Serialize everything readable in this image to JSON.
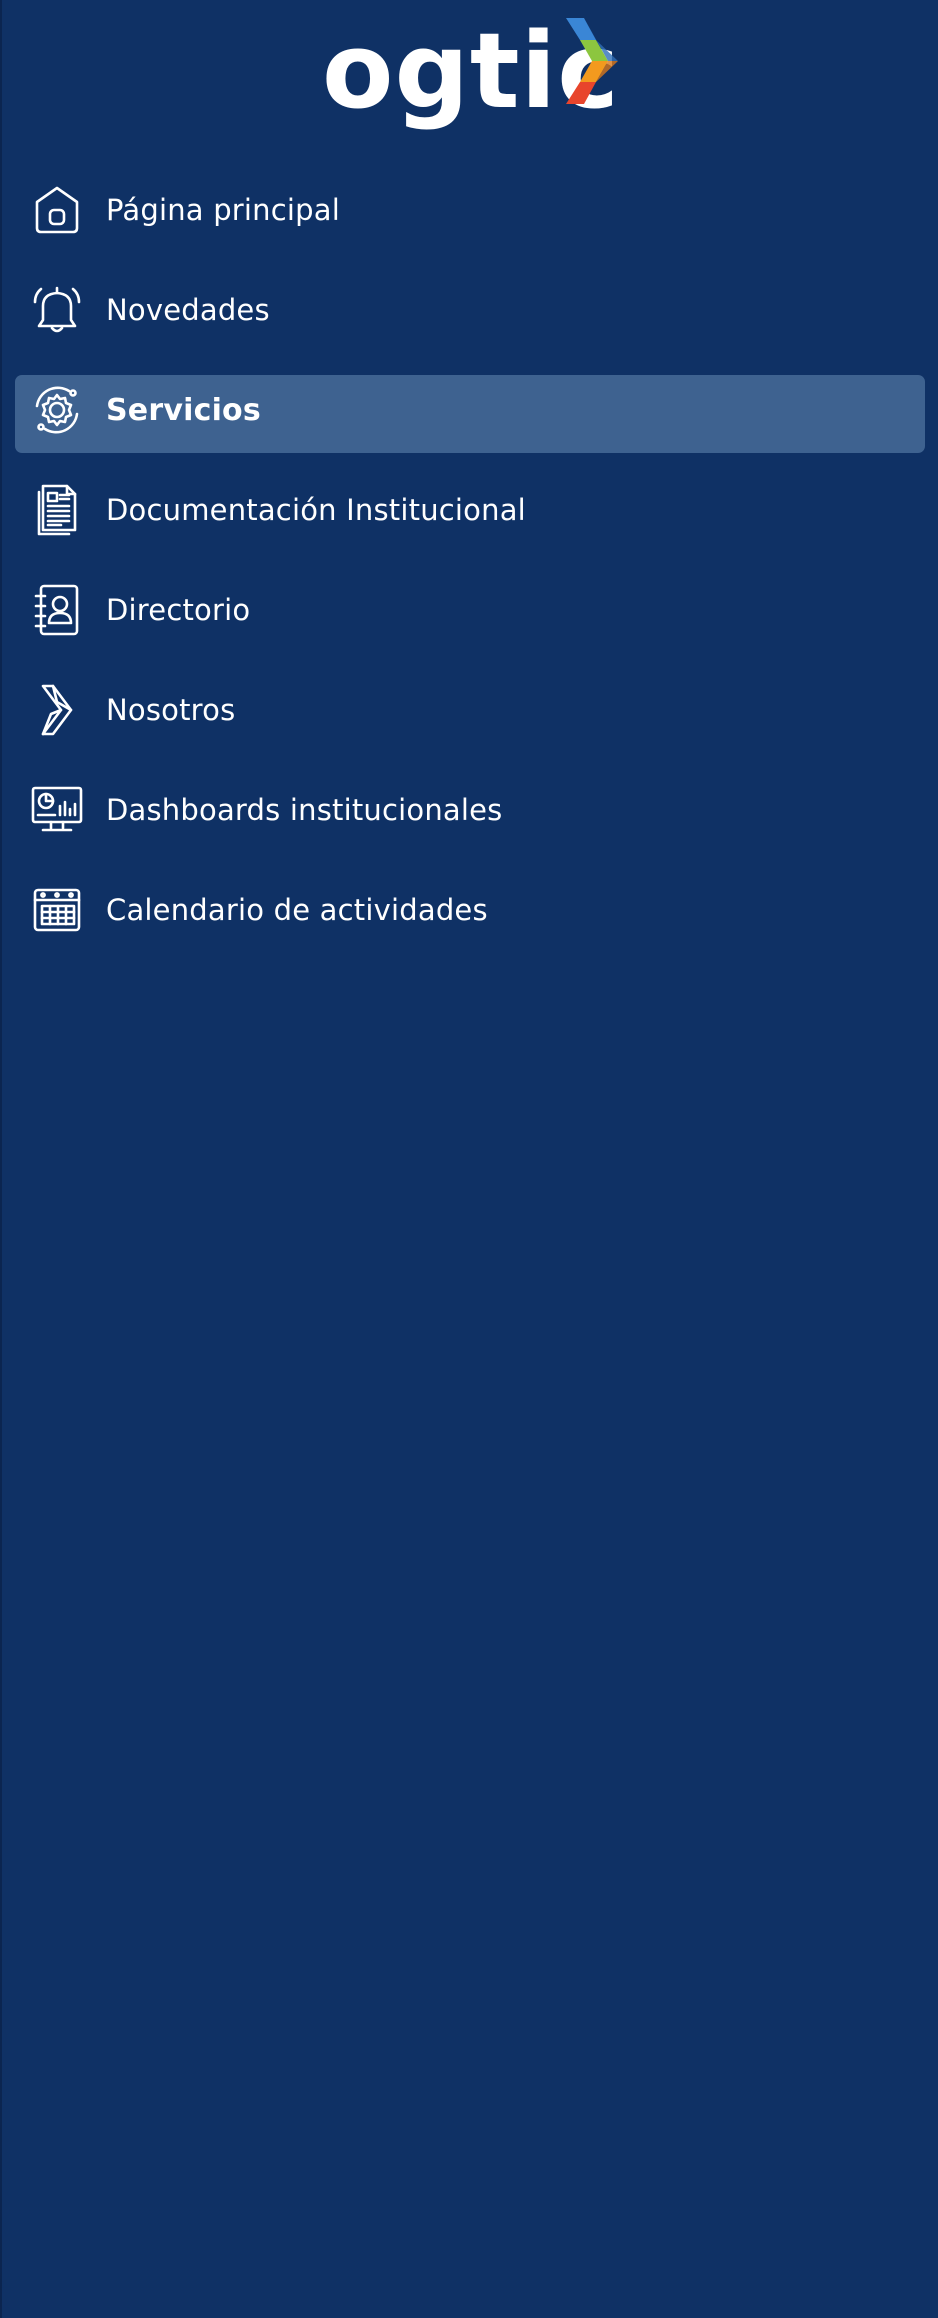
{
  "app": {
    "logo_text": "ogtic",
    "colors": {
      "background": "#0f3165",
      "active_item_background": "#3e6290",
      "text": "#ffffff",
      "logo_blue": "#3a86d6",
      "logo_green": "#8cc63f",
      "logo_orange": "#f39a1e",
      "logo_red": "#e8452c"
    }
  },
  "menu": {
    "items": [
      {
        "label": "Página principal",
        "icon": "home-icon",
        "active": false
      },
      {
        "label": "Novedades",
        "icon": "bell-icon",
        "active": false
      },
      {
        "label": "Servicios",
        "icon": "gear-icon",
        "active": true
      },
      {
        "label": "Documentación Institucional",
        "icon": "document-icon",
        "active": false
      },
      {
        "label": "Directorio",
        "icon": "contact-book-icon",
        "active": false
      },
      {
        "label": "Nosotros",
        "icon": "ogtic-chevron-icon",
        "active": false
      },
      {
        "label": "Dashboards institucionales",
        "icon": "monitor-chart-icon",
        "active": false
      },
      {
        "label": "Calendario de actividades",
        "icon": "calendar-icon",
        "active": false
      }
    ]
  }
}
